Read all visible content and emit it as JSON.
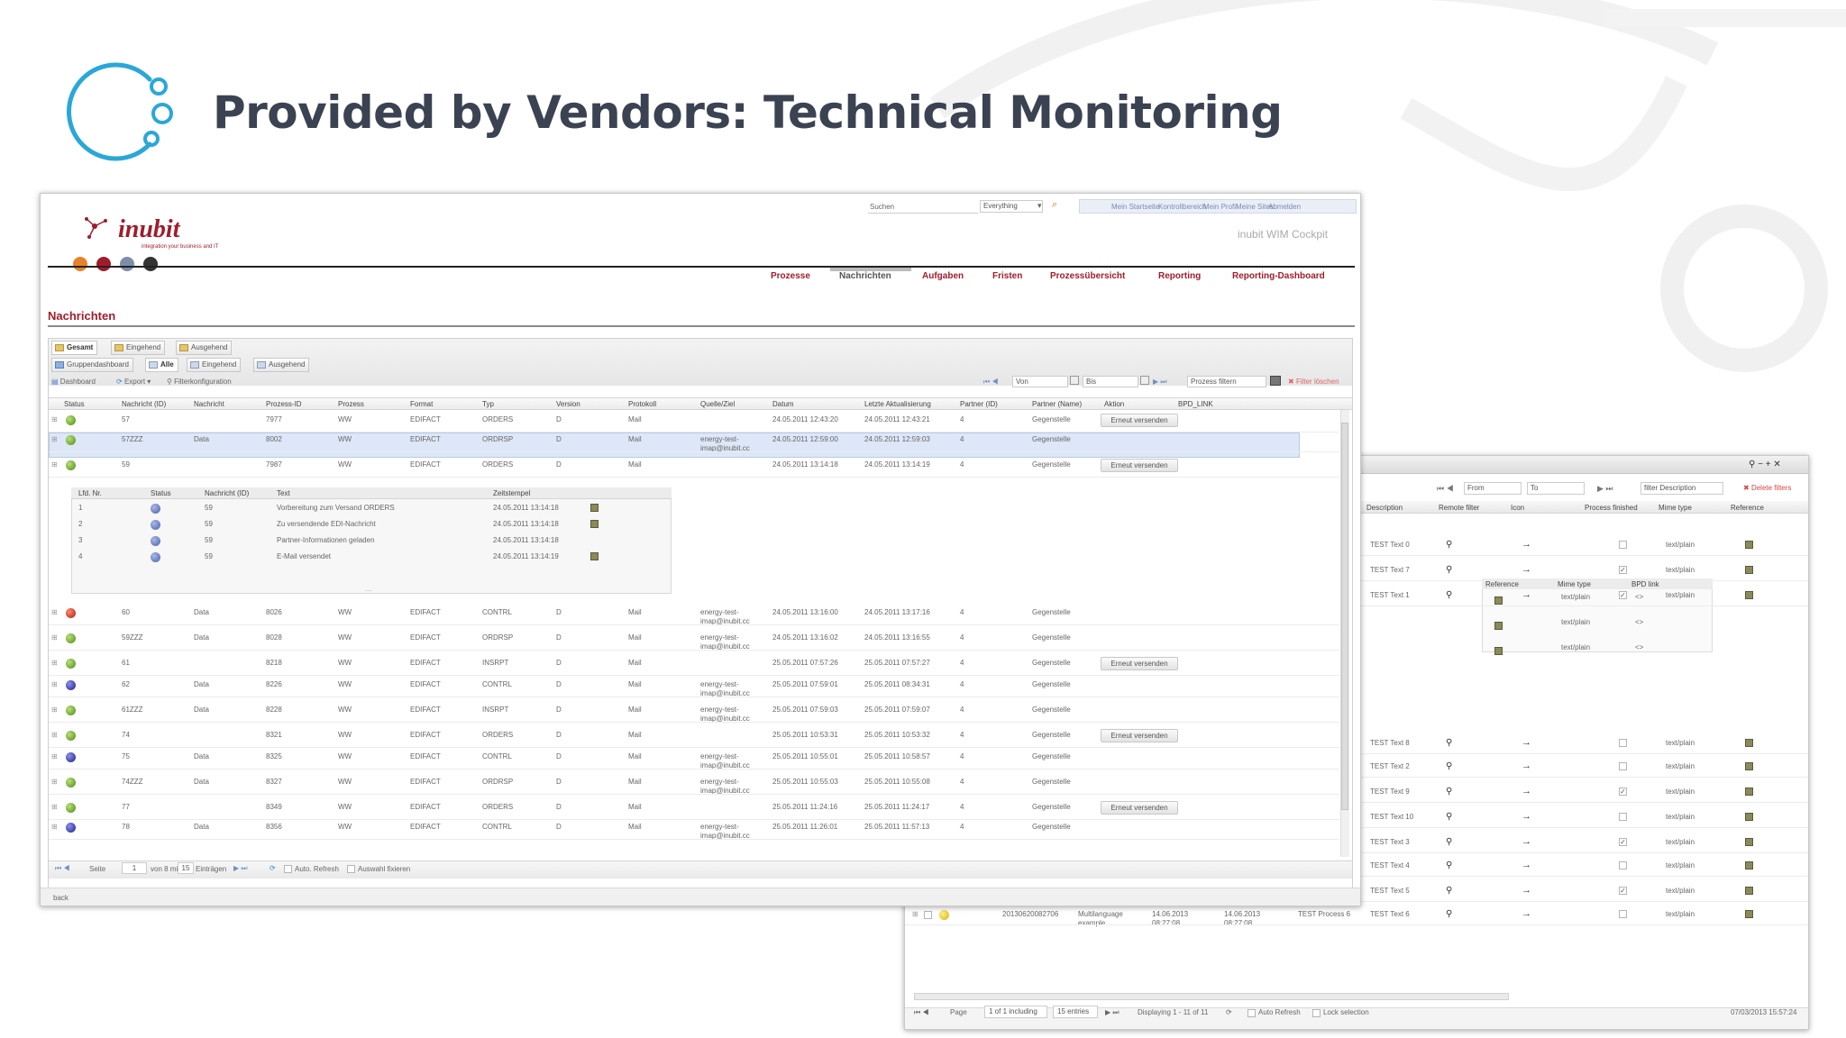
{
  "slide": {
    "title": "Provided by Vendors: Technical Monitoring"
  },
  "colors": {
    "title": "#3b4252",
    "logo": "#2aa7d8",
    "brand": "#a01c2b",
    "selected_row": "#dde7f8"
  },
  "inubit": {
    "logo_text": "inubit",
    "tagline": "integration your business and IT",
    "search_label": "Suchen",
    "search_scope": "Everything",
    "top_links": [
      "Mein Startseite",
      "Kontrollbereich",
      "Mein Profil",
      "Meine Sites",
      "Abmelden"
    ],
    "cockpit_title": "inubit WIM Cockpit",
    "nav": [
      "Prozesse",
      "Nachrichten",
      "Aufgaben",
      "Fristen",
      "Prozessübersicht",
      "Reporting",
      "Reporting-Dashboard"
    ],
    "active_nav": "Nachrichten",
    "page_title": "Nachrichten",
    "tabs1": [
      "Gesamt",
      "Eingehend",
      "Ausgehend"
    ],
    "tabs2": [
      "Gruppendashboard",
      "Alle",
      "Eingehend",
      "Ausgehend"
    ],
    "toolbar": {
      "dashboard": "Dashboard",
      "export": "Export",
      "filter_config": "Filterkonfiguration",
      "von": "Von",
      "bis": "Bis",
      "process_filter": "Prozess filtern",
      "filter_clear": "Filter löschen"
    },
    "columns": [
      "Status",
      "Nachricht (ID)",
      "Nachricht",
      "Prozess-ID",
      "Prozess",
      "Format",
      "Typ",
      "Version",
      "Protokoll",
      "Quelle/Ziel",
      "Datum",
      "Letzte Aktualisierung",
      "Partner (ID)",
      "Partner (Name)",
      "Aktion",
      "BPD_LINK"
    ],
    "rows": [
      {
        "status": "green",
        "msg_id": "57",
        "msg": "",
        "proc_id": "7977",
        "proc": "WW",
        "format": "EDIFACT",
        "type": "ORDERS",
        "version": "D",
        "protocol": "Mail",
        "source": "",
        "date": "24.05.2011 12:43:20",
        "updated": "24.05.2011 12:43:21",
        "partner_id": "4",
        "partner": "Gegenstelle",
        "action": "Erneut versenden"
      },
      {
        "status": "green",
        "msg_id": "57ZZZ",
        "msg": "Data",
        "proc_id": "8002",
        "proc": "WW",
        "format": "EDIFACT",
        "type": "ORDRSP",
        "version": "D",
        "protocol": "Mail",
        "source": "energy-test-imap@inubit.cc",
        "date": "24.05.2011 12:59:00",
        "updated": "24.05.2011 12:59:03",
        "partner_id": "4",
        "partner": "Gegenstelle",
        "action": ""
      },
      {
        "status": "green",
        "msg_id": "59",
        "msg": "",
        "proc_id": "7987",
        "proc": "WW",
        "format": "EDIFACT",
        "type": "ORDERS",
        "version": "D",
        "protocol": "Mail",
        "source": "",
        "date": "24.05.2011 13:14:18",
        "updated": "24.05.2011 13:14:19",
        "partner_id": "4",
        "partner": "Gegenstelle",
        "action": "Erneut versenden"
      },
      {
        "status": "red",
        "msg_id": "60",
        "msg": "Data",
        "proc_id": "8026",
        "proc": "WW",
        "format": "EDIFACT",
        "type": "CONTRL",
        "version": "D",
        "protocol": "Mail",
        "source": "energy-test-imap@inubit.cc",
        "date": "24.05.2011 13:16:00",
        "updated": "24.05.2011 13:17:16",
        "partner_id": "4",
        "partner": "Gegenstelle",
        "action": ""
      },
      {
        "status": "green",
        "msg_id": "59ZZZ",
        "msg": "Data",
        "proc_id": "8028",
        "proc": "WW",
        "format": "EDIFACT",
        "type": "ORDRSP",
        "version": "D",
        "protocol": "Mail",
        "source": "energy-test-imap@inubit.cc",
        "date": "24.05.2011 13:16:02",
        "updated": "24.05.2011 13:16:55",
        "partner_id": "4",
        "partner": "Gegenstelle",
        "action": ""
      },
      {
        "status": "green",
        "msg_id": "61",
        "msg": "",
        "proc_id": "8218",
        "proc": "WW",
        "format": "EDIFACT",
        "type": "INSRPT",
        "version": "D",
        "protocol": "Mail",
        "source": "",
        "date": "25.05.2011 07:57:26",
        "updated": "25.05.2011 07:57:27",
        "partner_id": "4",
        "partner": "Gegenstelle",
        "action": "Erneut versenden"
      },
      {
        "status": "blue",
        "msg_id": "62",
        "msg": "Data",
        "proc_id": "8226",
        "proc": "WW",
        "format": "EDIFACT",
        "type": "CONTRL",
        "version": "D",
        "protocol": "Mail",
        "source": "energy-test-imap@inubit.cc",
        "date": "25.05.2011 07:59:01",
        "updated": "25.05.2011 08:34:31",
        "partner_id": "4",
        "partner": "Gegenstelle",
        "action": ""
      },
      {
        "status": "green",
        "msg_id": "61ZZZ",
        "msg": "Data",
        "proc_id": "8228",
        "proc": "WW",
        "format": "EDIFACT",
        "type": "INSRPT",
        "version": "D",
        "protocol": "Mail",
        "source": "energy-test-imap@inubit.cc",
        "date": "25.05.2011 07:59:03",
        "updated": "25.05.2011 07:59:07",
        "partner_id": "4",
        "partner": "Gegenstelle",
        "action": ""
      },
      {
        "status": "green",
        "msg_id": "74",
        "msg": "",
        "proc_id": "8321",
        "proc": "WW",
        "format": "EDIFACT",
        "type": "ORDERS",
        "version": "D",
        "protocol": "Mail",
        "source": "",
        "date": "25.05.2011 10:53:31",
        "updated": "25.05.2011 10:53:32",
        "partner_id": "4",
        "partner": "Gegenstelle",
        "action": "Erneut versenden"
      },
      {
        "status": "blue",
        "msg_id": "75",
        "msg": "Data",
        "proc_id": "8325",
        "proc": "WW",
        "format": "EDIFACT",
        "type": "CONTRL",
        "version": "D",
        "protocol": "Mail",
        "source": "energy-test-imap@inubit.cc",
        "date": "25.05.2011 10:55:01",
        "updated": "25.05.2011 10:58:57",
        "partner_id": "4",
        "partner": "Gegenstelle",
        "action": ""
      },
      {
        "status": "green",
        "msg_id": "74ZZZ",
        "msg": "Data",
        "proc_id": "8327",
        "proc": "WW",
        "format": "EDIFACT",
        "type": "ORDRSP",
        "version": "D",
        "protocol": "Mail",
        "source": "energy-test-imap@inubit.cc",
        "date": "25.05.2011 10:55:03",
        "updated": "25.05.2011 10:55:08",
        "partner_id": "4",
        "partner": "Gegenstelle",
        "action": ""
      },
      {
        "status": "green",
        "msg_id": "77",
        "msg": "",
        "proc_id": "8349",
        "proc": "WW",
        "format": "EDIFACT",
        "type": "ORDERS",
        "version": "D",
        "protocol": "Mail",
        "source": "",
        "date": "25.05.2011 11:24:16",
        "updated": "25.05.2011 11:24:17",
        "partner_id": "4",
        "partner": "Gegenstelle",
        "action": "Erneut versenden"
      },
      {
        "status": "blue",
        "msg_id": "78",
        "msg": "Data",
        "proc_id": "8356",
        "proc": "WW",
        "format": "EDIFACT",
        "type": "CONTRL",
        "version": "D",
        "protocol": "Mail",
        "source": "energy-test-imap@inubit.cc",
        "date": "25.05.2011 11:26:01",
        "updated": "25.05.2011 11:57:13",
        "partner_id": "4",
        "partner": "Gegenstelle",
        "action": ""
      }
    ],
    "sub_columns": [
      "Lfd. Nr.",
      "Status",
      "Nachricht (ID)",
      "Text",
      "Zeitstempel"
    ],
    "sub_rows": [
      {
        "nr": "1",
        "msg_id": "59",
        "text": "Vorbereitung zum Versand ORDERS",
        "time": "24.05.2011 13:14:18"
      },
      {
        "nr": "2",
        "msg_id": "59",
        "text": "Zu versendende EDI-Nachricht",
        "time": "24.05.2011 13:14:18"
      },
      {
        "nr": "3",
        "msg_id": "59",
        "text": "Partner-Informationen geladen",
        "time": "24.05.2011 13:14:18"
      },
      {
        "nr": "4",
        "msg_id": "59",
        "text": "E-Mail versendet",
        "time": "24.05.2011 13:14:19"
      }
    ],
    "pager": {
      "page_label": "Seite",
      "page_value": "1",
      "of_label": "von 8 mit",
      "entries_value": "15",
      "entries_label": "Einträgen",
      "auto_refresh": "Auto. Refresh",
      "fix_selection": "Auswahl fixieren"
    },
    "status_bar": "back"
  },
  "second": {
    "filters": {
      "from": "From",
      "to": "To",
      "description": "filter Description",
      "delete": "Delete filters"
    },
    "columns": [
      "Description",
      "Remote filter",
      "Icon",
      "Process finished",
      "Mime type",
      "Reference"
    ],
    "rows_top": [
      {
        "desc": "TEST Text 0",
        "checked": false,
        "mime": "text/plain"
      },
      {
        "desc": "TEST Text 7",
        "checked": true,
        "mime": "text/plain"
      },
      {
        "desc": "TEST Text 1",
        "checked": true,
        "mime": "text/plain"
      }
    ],
    "nested_columns": [
      "Reference",
      "Mime type",
      "BPD link"
    ],
    "nested_rows": [
      {
        "mime": "text/plain",
        "link": "<>"
      },
      {
        "mime": "text/plain",
        "link": "<>"
      },
      {
        "mime": "text/plain",
        "link": "<>"
      }
    ],
    "rows_bottom": [
      {
        "desc": "TEST Text 8",
        "checked": false,
        "mime": "text/plain"
      },
      {
        "desc": "TEST Text 2",
        "checked": false,
        "mime": "text/plain"
      },
      {
        "desc": "TEST Text 9",
        "checked": true,
        "mime": "text/plain"
      },
      {
        "desc": "TEST Text 10",
        "checked": false,
        "mime": "text/plain"
      },
      {
        "desc": "TEST Text 3",
        "checked": true,
        "mime": "text/plain"
      },
      {
        "desc": "TEST Text 4",
        "checked": false,
        "mime": "text/plain"
      },
      {
        "desc": "TEST Text 5",
        "checked": true,
        "mime": "text/plain"
      },
      {
        "desc": "TEST Text 6",
        "checked": false,
        "mime": "text/plain"
      }
    ],
    "left_row": {
      "id": "20130620082706",
      "name": "Multilanguage example",
      "start": "14.06.2013 08:27:08",
      "end": "14.06.2013 08:27:08",
      "process": "TEST Process 6"
    },
    "pager": {
      "page_label": "Page",
      "page_text": "1 of 1 including",
      "entries": "15 entries",
      "displaying": "Displaying 1 - 11 of 11",
      "auto_refresh": "Auto Refresh",
      "lock_selection": "Lock selection",
      "timestamp": "07/03/2013 15:57:24"
    }
  }
}
